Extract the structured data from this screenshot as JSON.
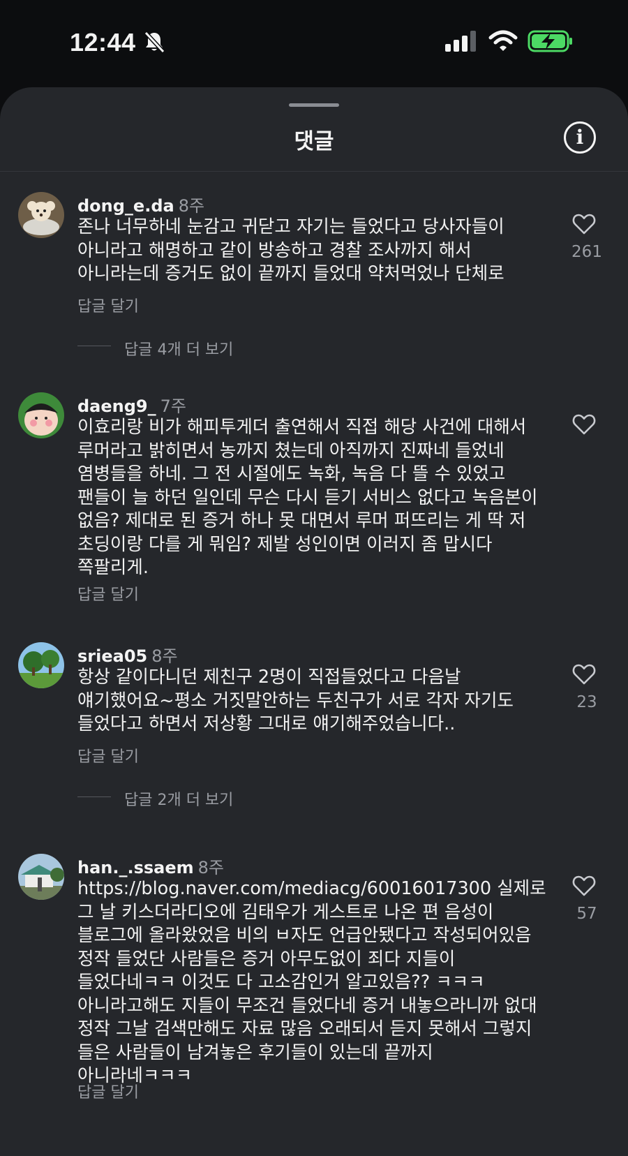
{
  "status_bar": {
    "time": "12:44"
  },
  "sheet": {
    "title": "댓글"
  },
  "labels": {
    "info": "i"
  },
  "comments": [
    {
      "username": "dong_e.da",
      "time_ago": "8주",
      "text": "존나 너무하네 눈감고 귀닫고 자기는 들었다고 당사자들이 아니라고 해명하고 같이 방송하고 경찰 조사까지 해서 아니라는데 증거도 없이 끝까지 들었대 약처먹었나 단체로",
      "likes": "261",
      "reply_label": "답글 달기",
      "more_replies": "답글 4개 더 보기"
    },
    {
      "username": "daeng9_",
      "time_ago": "7주",
      "text": "이효리랑 비가 해피투게더 출연해서 직접 해당 사건에 대해서 루머라고 밝히면서 농까지 쳤는데 아직까지 진짜네 들었네 염병들을 하네. 그 전 시절에도 녹화, 녹음 다 뜰 수 있었고 팬들이 늘 하던 일인데 무슨 다시 듣기 서비스 없다고 녹음본이 없음? 제대로 된 증거 하나 못 대면서 루머 퍼뜨리는 게 딱 저 초딩이랑 다를 게 뭐임? 제발 성인이면 이러지 좀 맙시다 쪽팔리게.",
      "likes": "",
      "reply_label": "답글 달기",
      "more_replies": ""
    },
    {
      "username": "sriea05",
      "time_ago": "8주",
      "text": "항상 같이다니던 제친구 2명이 직접들었다고 다음날 얘기했어요~평소 거짓말안하는 두친구가 서로 각자 자기도 들었다고 하면서 저상황 그대로 얘기해주었습니다..",
      "likes": "23",
      "reply_label": "답글 달기",
      "more_replies": "답글 2개 더 보기"
    },
    {
      "username": "han._.ssaem",
      "time_ago": "8주",
      "text": "https://blog.naver.com/mediacg/60016017300  실제로 그 날 키스더라디오에 김태우가 게스트로 나온 편 음성이 블로그에 올라왔었음 비의 ㅂ자도 언급안됐다고 작성되어있음 정작 들었단 사람들은 증거 아무도없이 죄다 지들이 들었다네ㅋㅋ 이것도 다 고소감인거 알고있음?? ㅋㅋㅋ 아니라고해도 지들이 무조건 들었다네 증거 내놓으라니까 없대 정작 그날 검색만해도 자료 많음 오래되서 듣지 못해서 그렇지 들은 사람들이 남겨놓은 후기들이 있는데 끝까지 아니라네ㅋㅋㅋ",
      "likes": "57",
      "reply_label": "답글 달기",
      "more_replies": ""
    }
  ],
  "colors": {
    "background": "#0c0d0f",
    "sheet": "#25272b",
    "text": "#f2f2f2",
    "muted": "#9a9da3",
    "battery_fill": "#4cd964"
  },
  "icons": [
    "bell-slash-icon",
    "cellular-signal-icon",
    "wifi-icon",
    "battery-charging-icon",
    "info-icon",
    "heart-icon"
  ]
}
